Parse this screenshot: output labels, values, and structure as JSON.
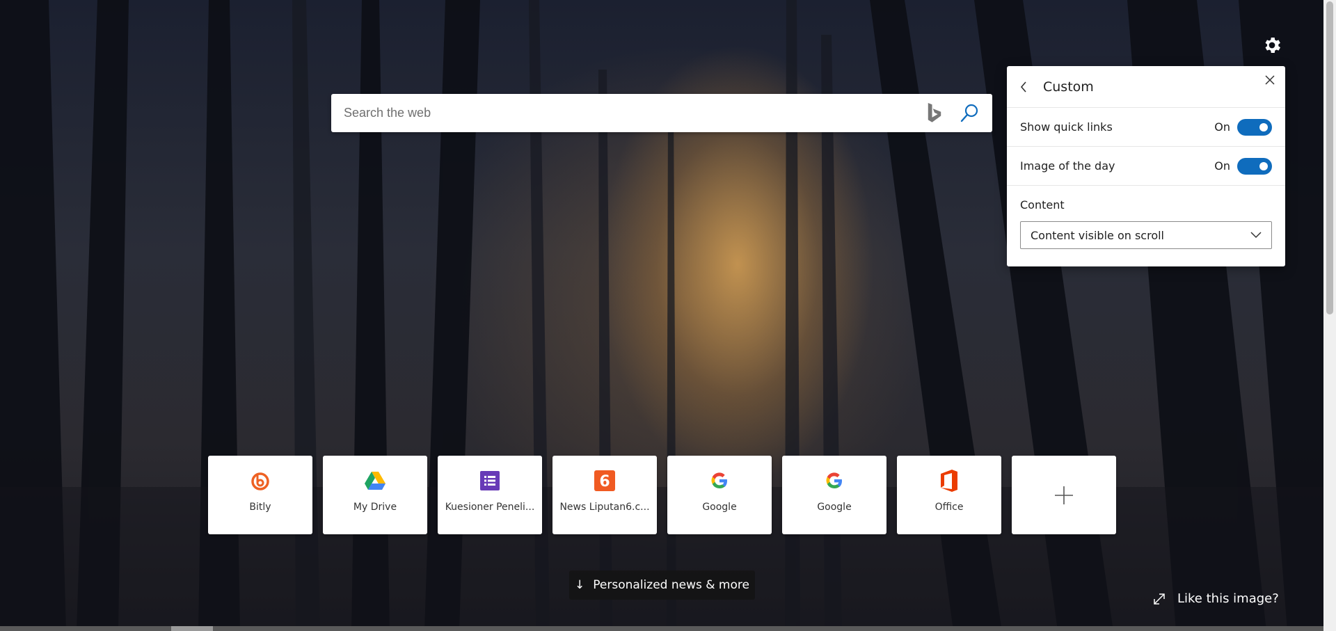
{
  "search": {
    "placeholder": "Search the web",
    "bing_icon": "bing-logo-icon",
    "search_icon": "magnifier-icon"
  },
  "settings": {
    "icon": "gear-icon"
  },
  "panel": {
    "title": "Custom",
    "rows": [
      {
        "label": "Show quick links",
        "state": "On",
        "toggled": true
      },
      {
        "label": "Image of the day",
        "state": "On",
        "toggled": true
      }
    ],
    "content_label": "Content",
    "content_select": "Content visible on scroll"
  },
  "quick_links": [
    {
      "name": "Bitly",
      "icon": "bitly-icon",
      "color": "#ee6123"
    },
    {
      "name": "My Drive",
      "icon": "google-drive-icon",
      "color": "#1fa463"
    },
    {
      "name": "Kuesioner Peneli...",
      "icon": "google-forms-icon",
      "color": "#673ab7"
    },
    {
      "name": "News Liputan6.c...",
      "icon": "liputan6-icon",
      "color": "#f05a22"
    },
    {
      "name": "Google",
      "icon": "google-icon",
      "color": "#4285f4"
    },
    {
      "name": "Google",
      "icon": "google-icon",
      "color": "#4285f4"
    },
    {
      "name": "Office",
      "icon": "office-icon",
      "color": "#eb3c00"
    }
  ],
  "add_tile": {
    "icon": "plus-icon"
  },
  "news_button": {
    "label": "Personalized news & more"
  },
  "like_image": {
    "label": "Like this image?"
  }
}
